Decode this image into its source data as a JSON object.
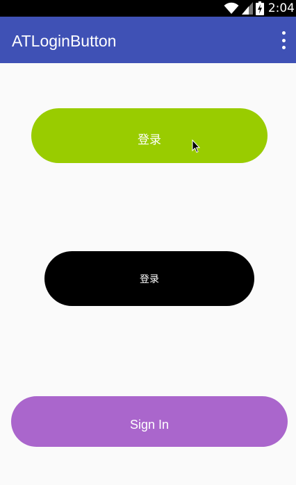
{
  "status_bar": {
    "time": "2:04",
    "icons": [
      "wifi-icon",
      "cell-signal-icon",
      "battery-charging-icon"
    ]
  },
  "app_bar": {
    "title": "ATLoginButton",
    "menu_icon": "overflow-menu-icon"
  },
  "buttons": [
    {
      "label": "登录",
      "color": "#99cc00"
    },
    {
      "label": "登录",
      "color": "#000000"
    },
    {
      "label": "Sign In",
      "color": "#aa66cc"
    }
  ],
  "colors": {
    "app_bar": "#3f51b5",
    "status_bar": "#000000",
    "background": "#fafafa"
  }
}
